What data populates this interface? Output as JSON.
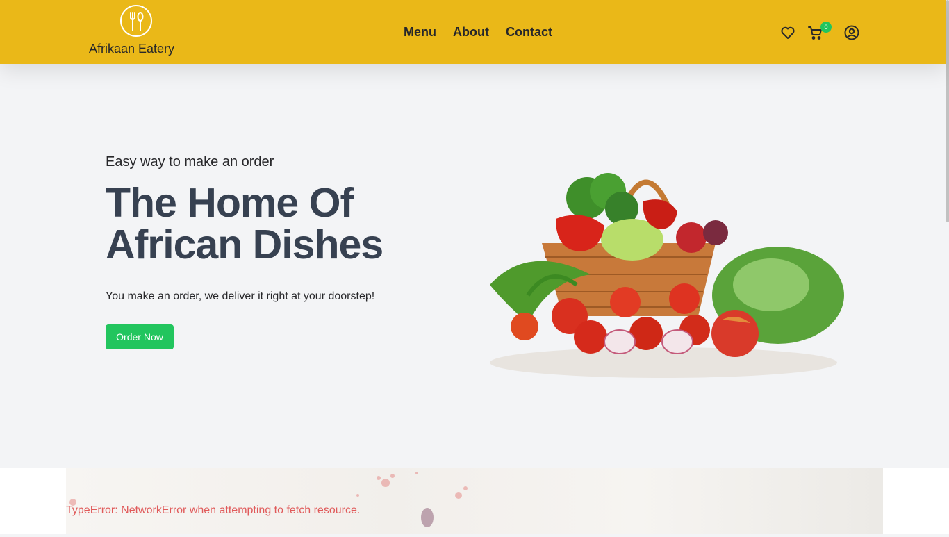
{
  "brand": {
    "name": "Afrikaan Eatery",
    "logo_icon": "utensils-icon"
  },
  "nav": {
    "items": [
      "Menu",
      "About",
      "Contact"
    ]
  },
  "header_icons": {
    "wishlist": "heart-icon",
    "cart": "cart-icon",
    "cart_count": "0",
    "account": "user-circle-icon"
  },
  "hero": {
    "subtitle": "Easy way to make an order",
    "title_line1": "The Home Of",
    "title_line2": "African Dishes",
    "description": "You make an order, we deliver it right at your doorstep!",
    "cta_label": "Order Now"
  },
  "error": {
    "message": "TypeError: NetworkError when attempting to fetch resource."
  },
  "colors": {
    "header_bg": "#eab818",
    "accent_green": "#22c55e",
    "text_dark": "#374151",
    "error_red": "#e05a5a"
  }
}
